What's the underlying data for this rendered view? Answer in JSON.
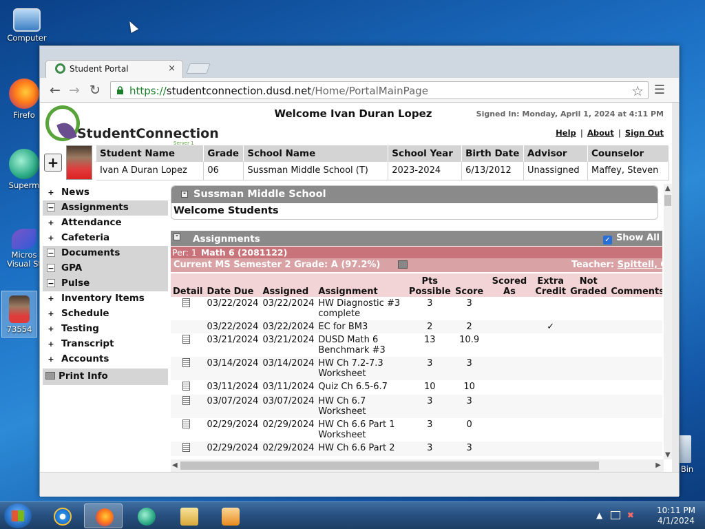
{
  "desktop": {
    "icons": [
      {
        "label": "Computer"
      },
      {
        "label": "Firefo"
      },
      {
        "label": "Superm"
      },
      {
        "label": "Micros Visual St"
      },
      {
        "label": "73554"
      },
      {
        "label": "Bin"
      }
    ]
  },
  "browser": {
    "tab_title": "Student Portal",
    "tab_close": "×",
    "url_scheme": "https://",
    "url_host": "studentconnection.dusd.net",
    "url_path": "/Home/PortalMainPage"
  },
  "header": {
    "logo_text": "StudentConnection",
    "logo_sub": "Server 1",
    "welcome": "Welcome Ivan Duran Lopez",
    "signed_in": "Signed In: Monday, April 1, 2024 at 4:11 PM",
    "links": [
      "Help",
      "About",
      "Sign Out"
    ]
  },
  "student": {
    "columns": [
      "Student Name",
      "Grade",
      "School Name",
      "School Year",
      "Birth Date",
      "Advisor",
      "Counselor"
    ],
    "values": [
      "Ivan A Duran Lopez",
      "06",
      "Sussman Middle School (T)",
      "2023-2024",
      "6/13/2012",
      "Unassigned",
      "Maffey, Steven"
    ]
  },
  "sidebar": {
    "items": [
      {
        "label": "News",
        "sym": "+",
        "open": false
      },
      {
        "label": "Assignments",
        "sym": "−",
        "open": true
      },
      {
        "label": "Attendance",
        "sym": "+",
        "open": false
      },
      {
        "label": "Cafeteria",
        "sym": "+",
        "open": false
      },
      {
        "label": "Documents",
        "sym": "−",
        "open": true
      },
      {
        "label": "GPA",
        "sym": "−",
        "open": true
      },
      {
        "label": "Pulse",
        "sym": "−",
        "open": true
      },
      {
        "label": "Inventory Items",
        "sym": "+",
        "open": false
      },
      {
        "label": "Schedule",
        "sym": "+",
        "open": false
      },
      {
        "label": "Testing",
        "sym": "+",
        "open": false
      },
      {
        "label": "Transcript",
        "sym": "+",
        "open": false
      },
      {
        "label": "Accounts",
        "sym": "+",
        "open": false
      }
    ],
    "print_info": "Print Info"
  },
  "school_panel": {
    "title": "Sussman Middle School",
    "body": "Welcome Students"
  },
  "assignments": {
    "title": "Assignments",
    "show_all": "Show All",
    "period_label": "Per: 1",
    "course": "Math 6 (2081122)",
    "grade_line": "Current MS Semester 2 Grade: A (97.2%)",
    "teacher_label": "Teacher:",
    "teacher_name": "Spittell, C",
    "columns": [
      "Detail",
      "Date Due",
      "Assigned",
      "Assignment",
      "Pts Possible",
      "Score",
      "Scored As",
      "Extra Credit",
      "Not Graded",
      "Comments"
    ],
    "rows": [
      {
        "doc": true,
        "due": "03/22/2024",
        "assigned": "03/22/2024",
        "name": "HW Diagnostic #3 complete",
        "pts": "3",
        "score": "3",
        "extra": ""
      },
      {
        "doc": false,
        "due": "03/22/2024",
        "assigned": "03/22/2024",
        "name": "EC for BM3",
        "pts": "2",
        "score": "2",
        "extra": "✓"
      },
      {
        "doc": true,
        "due": "03/21/2024",
        "assigned": "03/21/2024",
        "name": "DUSD Math 6 Benchmark #3",
        "pts": "13",
        "score": "10.9",
        "extra": ""
      },
      {
        "doc": true,
        "due": "03/14/2024",
        "assigned": "03/14/2024",
        "name": "HW Ch 7.2-7.3 Worksheet",
        "pts": "3",
        "score": "3",
        "extra": ""
      },
      {
        "doc": true,
        "due": "03/11/2024",
        "assigned": "03/11/2024",
        "name": "Quiz Ch 6.5-6.7",
        "pts": "10",
        "score": "10",
        "extra": ""
      },
      {
        "doc": true,
        "due": "03/07/2024",
        "assigned": "03/07/2024",
        "name": "HW Ch 6.7 Worksheet",
        "pts": "3",
        "score": "3",
        "extra": ""
      },
      {
        "doc": true,
        "due": "02/29/2024",
        "assigned": "02/29/2024",
        "name": "HW Ch 6.6 Part 1 Worksheet",
        "pts": "3",
        "score": "0",
        "extra": ""
      },
      {
        "doc": true,
        "due": "02/29/2024",
        "assigned": "02/29/2024",
        "name": "HW Ch 6.6 Part 2",
        "pts": "3",
        "score": "3",
        "extra": ""
      }
    ]
  },
  "taskbar": {
    "time": "10:11 PM",
    "date": "4/1/2024"
  },
  "colors": {
    "accent_green": "#58a33a",
    "course_bar": "#c8737a",
    "grade_bar": "#d9a3a6",
    "panel_header": "#8a8a8a"
  }
}
